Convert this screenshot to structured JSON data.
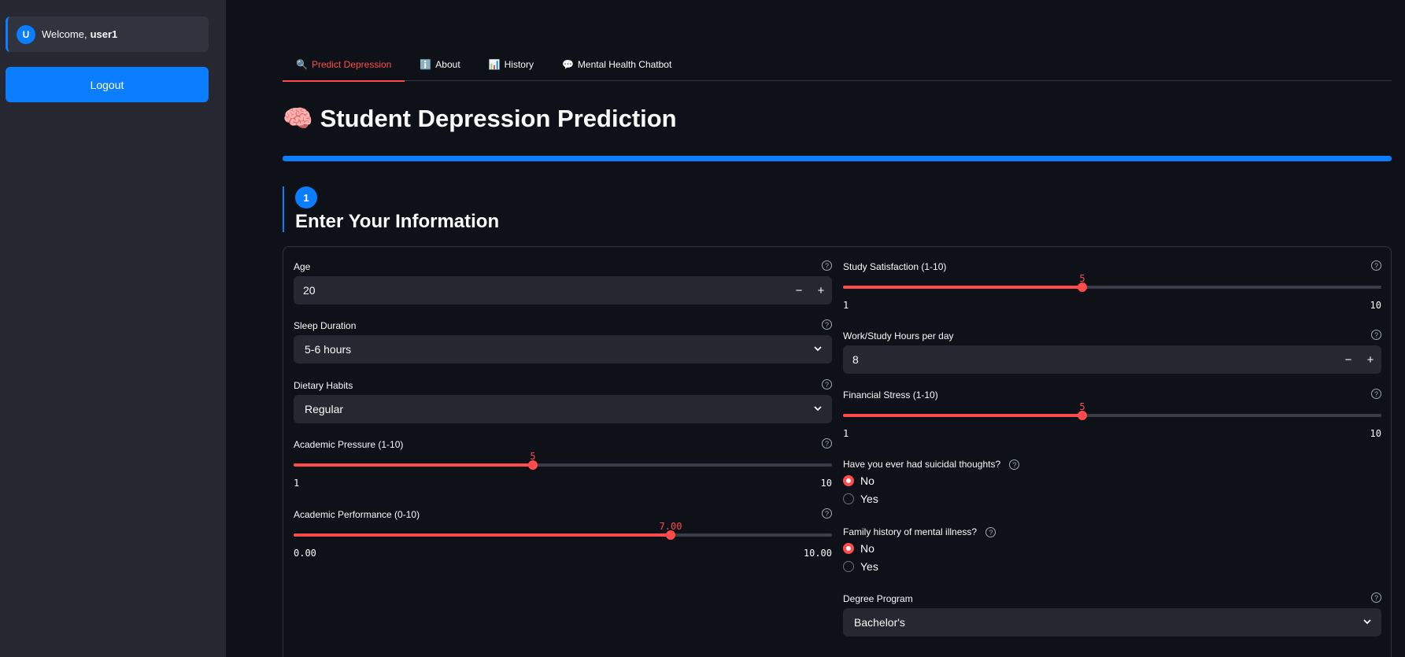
{
  "sidebar": {
    "avatar_letter": "U",
    "welcome_prefix": "Welcome,",
    "username": "user1",
    "logout_label": "Logout"
  },
  "tabs": [
    {
      "icon": "🔍",
      "label": "Predict Depression",
      "active": true
    },
    {
      "icon": "ℹ️",
      "label": "About",
      "active": false
    },
    {
      "icon": "📊",
      "label": "History",
      "active": false
    },
    {
      "icon": "💬",
      "label": "Mental Health Chatbot",
      "active": false
    }
  ],
  "page": {
    "icon": "🧠",
    "title": "Student Depression Prediction"
  },
  "section": {
    "step_number": "1",
    "title": "Enter Your Information"
  },
  "form": {
    "age": {
      "label": "Age",
      "value": "20"
    },
    "sleep": {
      "label": "Sleep Duration",
      "value": "5-6 hours"
    },
    "diet": {
      "label": "Dietary Habits",
      "value": "Regular"
    },
    "academic_pressure": {
      "label": "Academic Pressure (1-10)",
      "value": "5",
      "min": "1",
      "max": "10"
    },
    "academic_performance": {
      "label": "Academic Performance (0-10)",
      "value": "7.00",
      "min": "0.00",
      "max": "10.00"
    },
    "study_satisfaction": {
      "label": "Study Satisfaction (1-10)",
      "value": "5",
      "min": "1",
      "max": "10"
    },
    "work_hours": {
      "label": "Work/Study Hours per day",
      "value": "8"
    },
    "financial_stress": {
      "label": "Financial Stress (1-10)",
      "value": "5",
      "min": "1",
      "max": "10"
    },
    "suicidal": {
      "label": "Have you ever had suicidal thoughts?",
      "options": [
        "No",
        "Yes"
      ],
      "selected": "No"
    },
    "family_history": {
      "label": "Family history of mental illness?",
      "options": [
        "No",
        "Yes"
      ],
      "selected": "No"
    },
    "degree": {
      "label": "Degree Program",
      "value": "Bachelor's"
    }
  },
  "icons": {
    "help": "?",
    "minus": "−",
    "plus": "+",
    "chevron": "⌄"
  },
  "colors": {
    "accent": "#ff4b4b",
    "primary": "#0b7dff",
    "background": "#0e1117",
    "sidebar": "#262730"
  }
}
